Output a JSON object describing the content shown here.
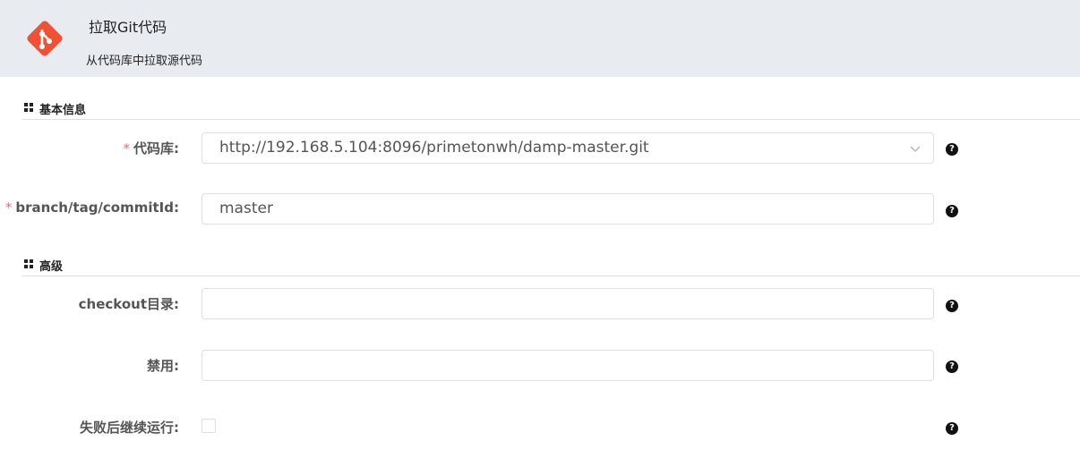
{
  "header": {
    "title": "拉取Git代码",
    "subtitle": "从代码库中拉取源代码",
    "logo_color": "#f05033"
  },
  "sections": {
    "basic": "基本信息",
    "advanced": "高级"
  },
  "fields": {
    "repo": {
      "required_mark": "*",
      "label": "代码库:",
      "value": "http://192.168.5.104:8096/primetonwh/damp-master.git"
    },
    "branch": {
      "required_mark": "*",
      "label": "branch/tag/commitId:",
      "value": "master"
    },
    "checkout": {
      "label": "checkout目录:",
      "value": ""
    },
    "disable": {
      "label": "禁用:",
      "value": ""
    },
    "continue_on_fail": {
      "label": "失败后继续运行:",
      "checked": false
    }
  },
  "help_icon_text": "?",
  "colors": {
    "required": "#f56c6c",
    "header_bg": "#e8ebf0"
  }
}
